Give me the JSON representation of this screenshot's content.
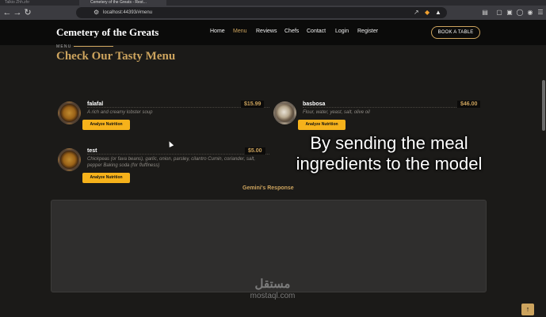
{
  "browser": {
    "tabs": [
      "Talkio Zhh.zhr",
      "Cemetery of the Greats - Rest..."
    ],
    "url": "localhost:44393/#menu"
  },
  "site": {
    "logo": "Cemetery of the Greats",
    "nav": [
      "Home",
      "Menu",
      "Reviews",
      "Chefs",
      "Contact",
      "Login",
      "Register"
    ],
    "active_nav": "Menu",
    "book_button": "BOOK A TABLE"
  },
  "section": {
    "subtitle": "MENU",
    "title": "Check Our Tasty Menu"
  },
  "dishes": [
    {
      "name": "falafal",
      "price": "$15.99",
      "description": "A rich and creamy lobster soup",
      "button": "Analyze Nutrition"
    },
    {
      "name": "basbosa",
      "price": "$46.00",
      "description": "Flour, water, yeast, salt, olive oil",
      "button": "Analyze Nutrition"
    },
    {
      "name": "test",
      "price": "$5.00",
      "description": "Chickpeas (or fava beans), garlic, onion, parsley, cilantro Cumin, coriander, salt, pepper Baking soda (for fluffiness)",
      "button": "Analyze Nutrition"
    }
  ],
  "response": {
    "title": "Gemini's Response",
    "text": ""
  },
  "overlay_caption": "By sending the meal ingredients to the model",
  "watermark": {
    "arabic": "مستقل",
    "latin": "mostaql.com"
  },
  "colors": {
    "accent": "#cda45e",
    "button": "#f6b21b",
    "background": "#1b1a18",
    "nav_background": "#0b0b0a"
  }
}
